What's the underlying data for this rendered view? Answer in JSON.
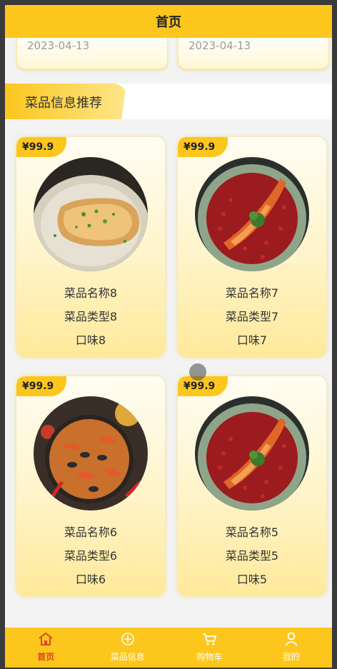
{
  "header": {
    "title": "首页"
  },
  "previous_cards": [
    {
      "date": "2023-04-13"
    },
    {
      "date": "2023-04-13"
    }
  ],
  "section": {
    "title": "菜品信息推荐"
  },
  "dishes": [
    {
      "price": "¥99.9",
      "name": "菜品名称8",
      "type": "菜品类型8",
      "taste": "口味8",
      "image": "fried-tofu-plate"
    },
    {
      "price": "¥99.9",
      "name": "菜品名称7",
      "type": "菜品类型7",
      "taste": "口味7",
      "image": "lobster-chili-plate"
    },
    {
      "price": "¥99.9",
      "name": "菜品名称6",
      "type": "菜品类型6",
      "taste": "口味6",
      "image": "seafood-paella-pan"
    },
    {
      "price": "¥99.9",
      "name": "菜品名称5",
      "type": "菜品类型5",
      "taste": "口味5",
      "image": "lobster-chili-plate"
    }
  ],
  "tabbar": {
    "items": [
      {
        "label": "首页",
        "icon": "home-icon",
        "active": true
      },
      {
        "label": "菜品信息",
        "icon": "dish-icon",
        "active": false
      },
      {
        "label": "购物车",
        "icon": "cart-icon",
        "active": false
      },
      {
        "label": "我的",
        "icon": "user-icon",
        "active": false
      }
    ]
  },
  "colors": {
    "accent": "#fcc61d",
    "active_tab": "#e0461e",
    "inactive_tab": "#ffffff"
  }
}
